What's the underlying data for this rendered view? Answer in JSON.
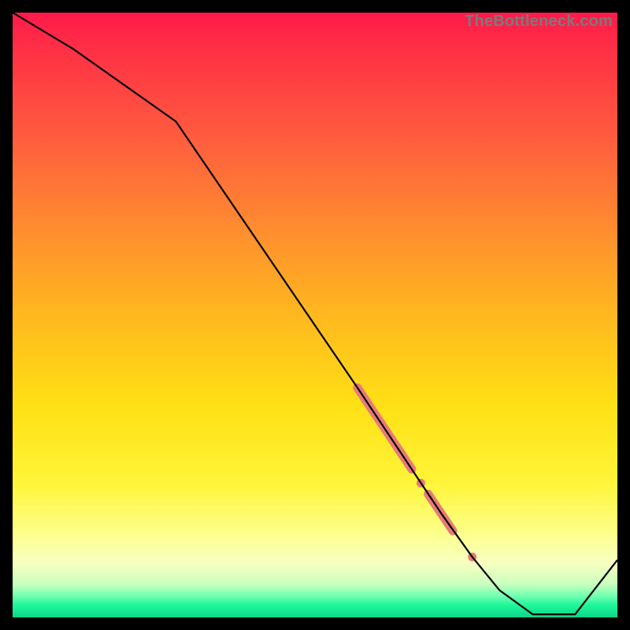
{
  "watermark": "TheBottleneck.com",
  "chart_data": {
    "type": "line",
    "title": "",
    "xlabel": "",
    "ylabel": "",
    "xlim": [
      0,
      100
    ],
    "ylim": [
      0,
      100
    ],
    "series": [
      {
        "name": "main-curve",
        "x": [
          0,
          10,
          27,
          57,
          62,
          66,
          71,
          76,
          80.5,
          86,
          93,
          100
        ],
        "y": [
          100,
          94,
          82,
          38,
          30.5,
          24.5,
          17,
          10,
          4.5,
          0.5,
          0.5,
          9.5
        ]
      }
    ],
    "markers": [
      {
        "kind": "thick-segment",
        "x1": 57,
        "y1": 38,
        "x2": 66,
        "y2": 24.5
      },
      {
        "kind": "dot",
        "x": 67.5,
        "y": 22.2
      },
      {
        "kind": "thick-segment",
        "x1": 68.7,
        "y1": 20.4,
        "x2": 72.8,
        "y2": 14.3
      },
      {
        "kind": "dot",
        "x": 76,
        "y": 10
      }
    ],
    "colors": {
      "line": "#000000",
      "marker": "#e97a78"
    }
  }
}
